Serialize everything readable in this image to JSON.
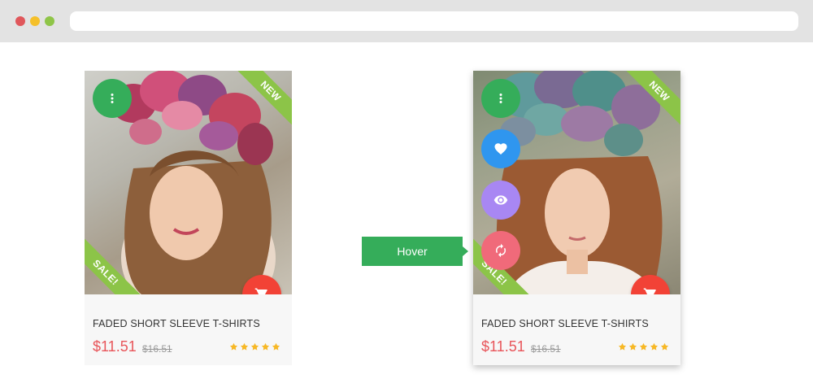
{
  "colors": {
    "green": "#35ad5a",
    "ribbon_green": "#8cc448",
    "blue": "#2f96ef",
    "purple": "#a887f3",
    "pink": "#f06a7a",
    "red": "#f24236",
    "price_red": "#e8555a",
    "star_yellow": "#f7b825"
  },
  "cards": [
    {
      "badge_new": "NEW",
      "badge_sale": "SALE!",
      "title": "FADED SHORT SLEEVE T-SHIRTS",
      "price": "$11.51",
      "old_price": "$16.51",
      "rating": 5,
      "icons": [
        "more-vert-icon",
        "cart-icon"
      ]
    },
    {
      "badge_new": "NEW",
      "badge_sale": "SALE!",
      "title": "FADED SHORT SLEEVE T-SHIRTS",
      "price": "$11.51",
      "old_price": "$16.51",
      "rating": 5,
      "icons": [
        "more-vert-icon",
        "heart-icon",
        "eye-icon",
        "refresh-icon",
        "cart-icon"
      ]
    }
  ],
  "hover_label": "Hover"
}
